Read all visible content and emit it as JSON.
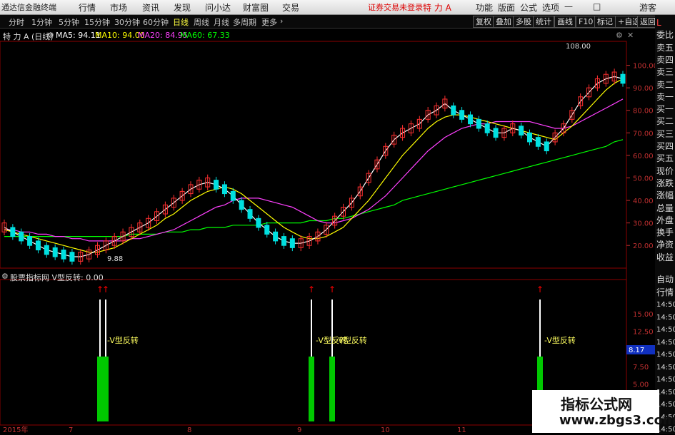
{
  "app": {
    "title": "通达信金融终端",
    "menu": [
      "行情",
      "市场",
      "资讯",
      "发现",
      "问小达",
      "财富圈",
      "交易"
    ],
    "notice": "证券交易未登录",
    "stock_name_top": "特 力 A",
    "right_menu": [
      "功能",
      "版面",
      "公式",
      "选项"
    ],
    "guest": "游客"
  },
  "toolbar": {
    "tabs": [
      "分时",
      "1分钟",
      "5分钟",
      "15分钟",
      "30分钟",
      "60分钟",
      "日线",
      "周线",
      "月线",
      "多周期",
      "更多"
    ],
    "active_tab": "日线",
    "right_buttons": [
      "复权",
      "叠加",
      "多股",
      "统计",
      "画线",
      "F10",
      "标记",
      "+自选",
      "返回"
    ]
  },
  "legend": {
    "title": "特 力 A (日线)",
    "ma5": "MA5: 94.11",
    "ma10": "MA10: 94.00",
    "ma20": "MA20: 84.95",
    "ma60": "MA60: 67.33"
  },
  "indicator": {
    "title": "股票指标网  V型反转: 0.00",
    "signal_label": "V型反转"
  },
  "annotations": {
    "high": "108.00",
    "low": "9.88",
    "current_marker": "8.17"
  },
  "right_panel": {
    "top": [
      "L",
      "委比",
      "卖五",
      "卖四",
      "卖三",
      "卖二",
      "卖一",
      "买一",
      "买二",
      "买三",
      "买四",
      "买五",
      "现价",
      "涨跌",
      "涨幅",
      "总量",
      "外盘",
      "换手",
      "净资",
      "收益"
    ],
    "bottom": [
      "自动",
      "行情",
      "14:50",
      "14:50",
      "14:50",
      "14:50",
      "14:50",
      "14:50",
      "14:50",
      "14:50",
      "14:50",
      "14:50",
      "14:50"
    ]
  },
  "watermark": {
    "line1": "指标公式网",
    "line2": "www.zbgs3.com"
  },
  "colors": {
    "up": "#ff3030",
    "down": "#00e0e0",
    "ma5": "#ffffff",
    "ma10": "#ffff00",
    "ma20": "#ff40ff",
    "ma60": "#00ff00",
    "ind_bar": "#00c800",
    "arrow": "#ff0000"
  },
  "chart_data": {
    "type": "candlestick",
    "y_axis_main": [
      "100.00",
      "90.00",
      "80.00",
      "70.00",
      "60.00",
      "50.00",
      "40.00",
      "30.00",
      "20.00"
    ],
    "y_axis_indicator": [
      "15.00",
      "12.50",
      "10.00",
      "7.50",
      "5.00",
      "2.50"
    ],
    "x_labels": [
      "2015年",
      "7",
      "8",
      "9",
      "10",
      "11",
      "12"
    ],
    "series_main": {
      "ma5": [
        28,
        26,
        24,
        22,
        20,
        18,
        17,
        16,
        15,
        15,
        16,
        18,
        20,
        22,
        24,
        26,
        28,
        30,
        33,
        36,
        39,
        42,
        45,
        47,
        48,
        47,
        45,
        42,
        38,
        34,
        30,
        27,
        24,
        22,
        21,
        21,
        22,
        24,
        27,
        31,
        35,
        39,
        44,
        50,
        56,
        62,
        67,
        70,
        72,
        74,
        78,
        80,
        83,
        80,
        78,
        76,
        74,
        72,
        70,
        70,
        72,
        71,
        68,
        66,
        64,
        68,
        72,
        78,
        84,
        88,
        92,
        94,
        95,
        94
      ],
      "ma10": [
        27,
        26,
        25,
        24,
        23,
        22,
        21,
        20,
        19,
        18,
        17,
        17,
        18,
        19,
        21,
        23,
        25,
        27,
        29,
        32,
        34,
        37,
        40,
        42,
        44,
        45,
        46,
        45,
        43,
        40,
        37,
        34,
        31,
        28,
        26,
        24,
        23,
        23,
        24,
        26,
        28,
        32,
        36,
        40,
        45,
        50,
        55,
        60,
        64,
        68,
        72,
        75,
        77,
        78,
        78,
        77,
        76,
        75,
        74,
        73,
        72,
        71,
        70,
        69,
        68,
        67,
        70,
        73,
        77,
        81,
        85,
        89,
        92,
        94
      ],
      "ma20": [
        27,
        27,
        26,
        26,
        25,
        25,
        24,
        24,
        23,
        23,
        22,
        22,
        22,
        22,
        22,
        23,
        23,
        24,
        25,
        26,
        27,
        29,
        31,
        33,
        35,
        37,
        38,
        40,
        41,
        41,
        41,
        40,
        39,
        38,
        37,
        35,
        33,
        31,
        30,
        30,
        31,
        32,
        34,
        36,
        39,
        42,
        46,
        50,
        54,
        58,
        62,
        65,
        68,
        70,
        72,
        73,
        74,
        74,
        75,
        75,
        75,
        75,
        75,
        74,
        73,
        72,
        72,
        73,
        75,
        77,
        79,
        81,
        83,
        85
      ],
      "ma60": [
        24,
        24,
        24,
        24,
        24,
        24,
        24,
        24,
        24,
        24,
        24,
        24,
        24,
        24,
        24,
        25,
        25,
        25,
        25,
        26,
        26,
        26,
        27,
        27,
        28,
        28,
        28,
        29,
        29,
        29,
        29,
        30,
        30,
        30,
        30,
        30,
        31,
        31,
        31,
        32,
        32,
        33,
        34,
        35,
        36,
        37,
        38,
        40,
        41,
        42,
        43,
        44,
        45,
        46,
        47,
        48,
        49,
        50,
        51,
        52,
        53,
        54,
        55,
        56,
        57,
        58,
        59,
        60,
        61,
        62,
        63,
        64,
        66,
        67
      ]
    }
  }
}
